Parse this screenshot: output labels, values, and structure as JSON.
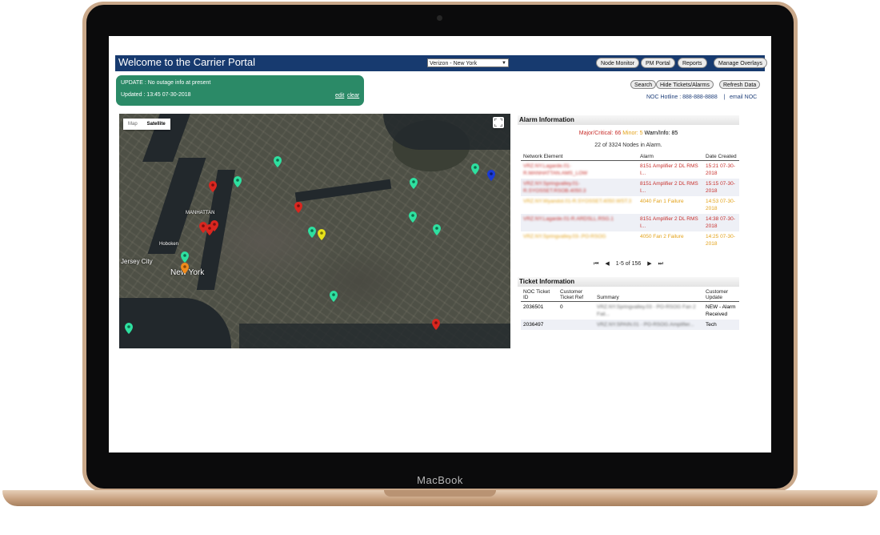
{
  "device": {
    "brand_label": "MacBook"
  },
  "header": {
    "title": "Welcome to the Carrier Portal",
    "region_select": "Verizon - New York",
    "nav": [
      "Node Monitor",
      "PM Portal",
      "Reports",
      "Manage Overlays"
    ]
  },
  "update": {
    "message": "UPDATE : No outage info at present",
    "updated": "Updated : 13:45 07-30-2018",
    "edit_label": "edit",
    "clear_label": "clear"
  },
  "actions": {
    "search": "Search",
    "hide": "Hide Tickets/Alarms",
    "refresh": "Refresh Data"
  },
  "contact": {
    "hotline": "NOC Hotline : 888-888-8888",
    "separator": "|",
    "email": "email NOC"
  },
  "map": {
    "toggle_map": "Map",
    "toggle_satellite": "Satellite",
    "active_view": "Satellite",
    "labels": [
      "MANHATTAN",
      "New York",
      "Jersey City",
      "Hoboken"
    ],
    "pin_colors": {
      "critical": "#d9261f",
      "minor": "#f08a1c",
      "warning": "#e8e21a",
      "clear": "#2ee0a0",
      "info": "#1a3ad4"
    }
  },
  "alarm_info": {
    "title": "Alarm Information",
    "major_critical": "Major/Critical: 66",
    "minor": "Minor: 5",
    "warn_info": "Warn/Info: 85",
    "nodes_in_alarm": "22 of 3324 Nodes in Alarm.",
    "columns": [
      "Network Element",
      "Alarm",
      "Date Created"
    ],
    "rows": [
      {
        "element": "VRZ.NY.Lagarde.01-R.MANHATTAN.AMS_LOW",
        "alarm": "8151 Amplifier 2 DL RMS I...",
        "date": "15:21 07-30-2018",
        "severity": "critical"
      },
      {
        "element": "VRZ.NY.Springvalley.01-R.SYOSSET.RSOB.4050.3",
        "alarm": "8151 Amplifier 2 DL RMS I...",
        "date": "15:15 07-30-2018",
        "severity": "critical"
      },
      {
        "element": "VRZ.NY.Wyandot.01-R.SYOSSET.4050.WST.3",
        "alarm": "4040 Fan 1 Failure",
        "date": "14:53 07-30-2018",
        "severity": "minor"
      },
      {
        "element": "VRZ.NY.Lagarde.01-R.ARDSLL.RSG.1",
        "alarm": "8151 Amplifier 2 DL RMS I...",
        "date": "14:38 07-30-2018",
        "severity": "critical"
      },
      {
        "element": "VRZ.NY.Springvalley.03-.PO-RSOG",
        "alarm": "4050 Fan 2 Failure",
        "date": "14:25 07-30-2018",
        "severity": "minor"
      }
    ],
    "pager": {
      "first": "⏮",
      "prev": "◀",
      "text": "1-5 of 156",
      "next": "▶",
      "last": "⏭"
    },
    "severity_colors": {
      "critical": "#c8302c",
      "minor": "#e3a21a"
    }
  },
  "ticket_info": {
    "title": "Ticket Information",
    "columns": [
      "NOC Ticket ID",
      "Customer Ticket Ref",
      "Summary",
      "Customer Update"
    ],
    "rows": [
      {
        "id": "2036501",
        "ref": "0",
        "summary": "VRZ.NY.Springvalley.03 - PO-RSOG Fan 2 Fail...",
        "update": "NEW - Alarm Received"
      },
      {
        "id": "2036497",
        "ref": "",
        "summary": "VRZ.NY.SPAIN.01 - PO-RSOG.Amplifier...",
        "update": "Tech"
      }
    ]
  }
}
